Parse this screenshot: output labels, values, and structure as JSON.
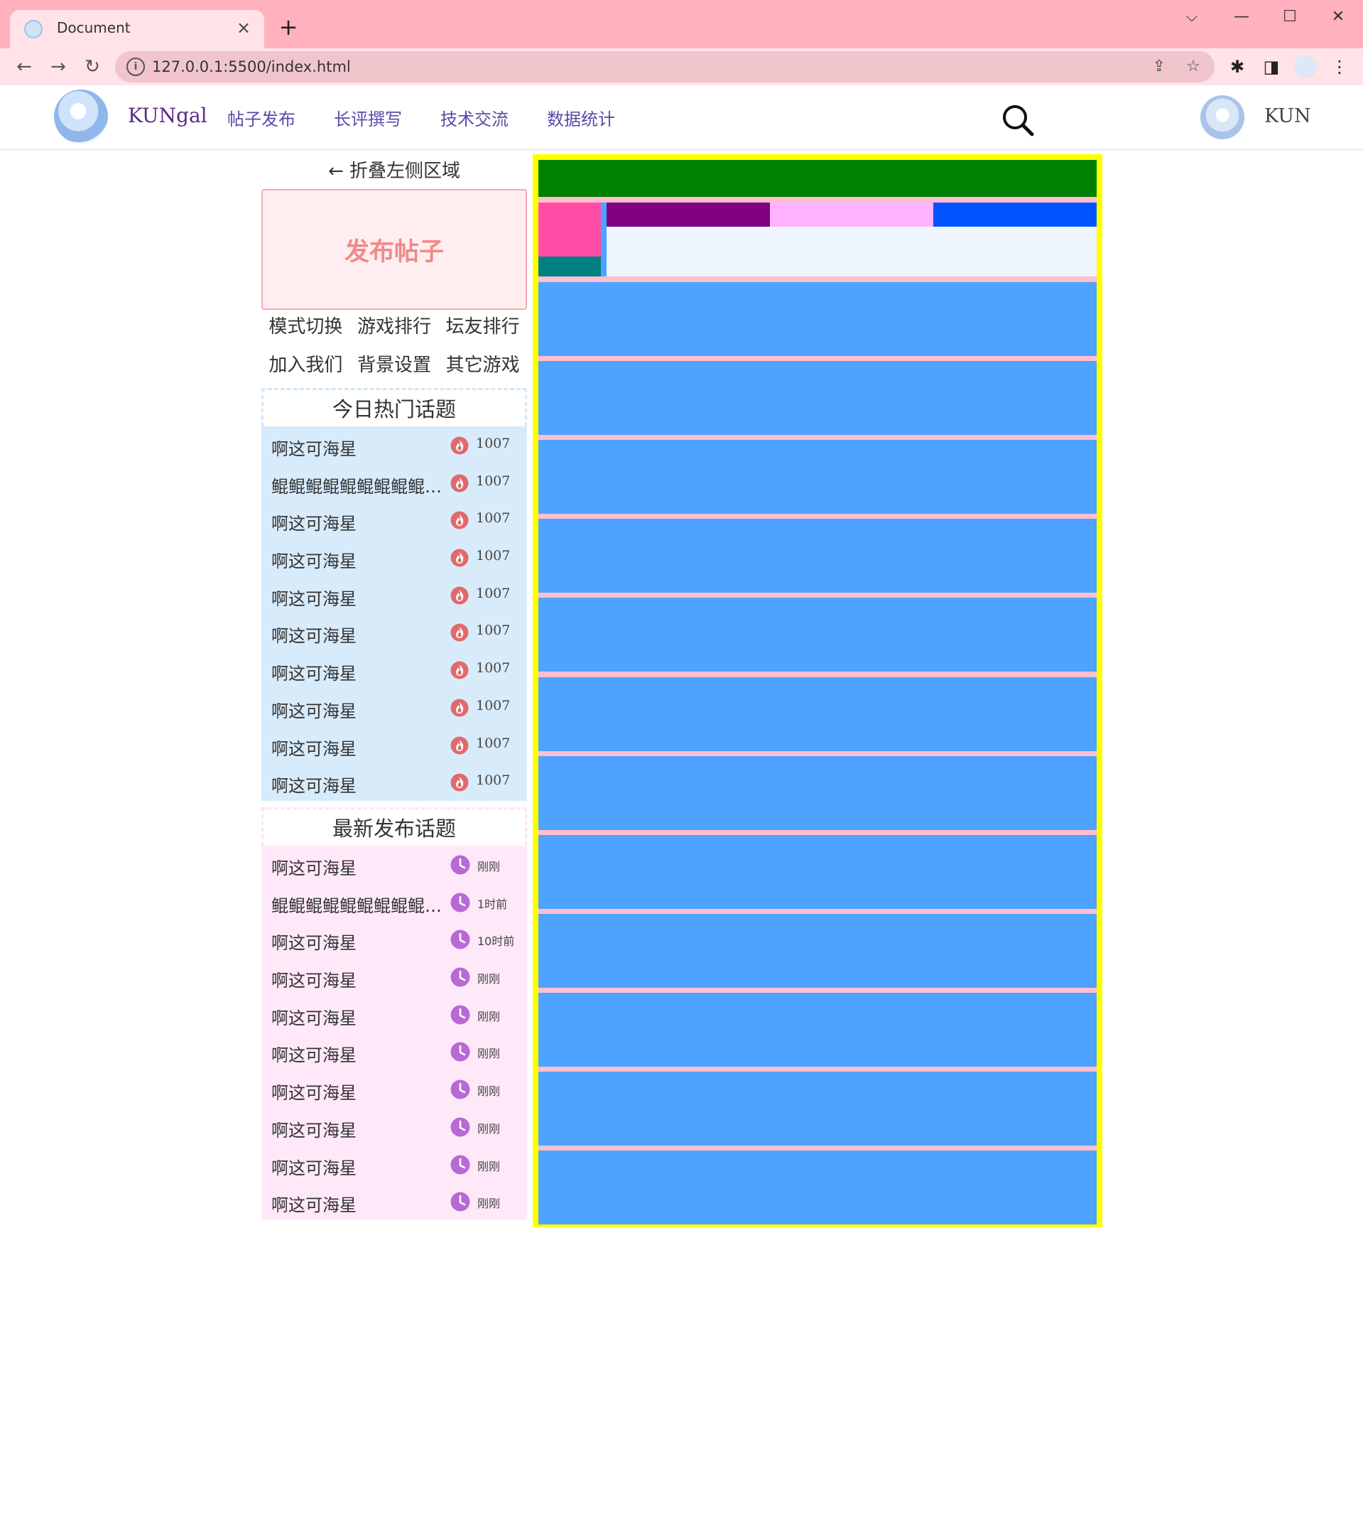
{
  "browser": {
    "tab_title": "Document",
    "tab_close": "×",
    "new_tab": "+",
    "url": "127.0.0.1:5500/index.html",
    "controls": {
      "dropdown": "⌵",
      "minimize": "—",
      "maximize": "☐",
      "close": "✕"
    }
  },
  "header": {
    "brand": "KUNgal",
    "nav": [
      "帖子发布",
      "长评撰写",
      "技术交流",
      "数据统计"
    ],
    "username": "KUN"
  },
  "sidebar": {
    "collapse_label": "折叠左侧区域",
    "publish_label": "发布帖子",
    "quick_links": [
      "模式切换",
      "游戏排行",
      "坛友排行",
      "加入我们",
      "背景设置",
      "其它游戏"
    ],
    "hot_topics": {
      "title": "今日热门话题",
      "items": [
        {
          "title": "啊这可海星",
          "count": "1007"
        },
        {
          "title": "鲲鲲鲲鲲鲲鲲鲲鲲鲲鲲鲲",
          "count": "1007"
        },
        {
          "title": "啊这可海星",
          "count": "1007"
        },
        {
          "title": "啊这可海星",
          "count": "1007"
        },
        {
          "title": "啊这可海星",
          "count": "1007"
        },
        {
          "title": "啊这可海星",
          "count": "1007"
        },
        {
          "title": "啊这可海星",
          "count": "1007"
        },
        {
          "title": "啊这可海星",
          "count": "1007"
        },
        {
          "title": "啊这可海星",
          "count": "1007"
        },
        {
          "title": "啊这可海星",
          "count": "1007"
        }
      ]
    },
    "new_topics": {
      "title": "最新发布话题",
      "items": [
        {
          "title": "啊这可海星",
          "time": "刚刚"
        },
        {
          "title": "鲲鲲鲲鲲鲲鲲鲲鲲鲲鲲鲲",
          "time": "1时前"
        },
        {
          "title": "啊这可海星",
          "time": "10时前"
        },
        {
          "title": "啊这可海星",
          "time": "刚刚"
        },
        {
          "title": "啊这可海星",
          "time": "刚刚"
        },
        {
          "title": "啊这可海星",
          "time": "刚刚"
        },
        {
          "title": "啊这可海星",
          "time": "刚刚"
        },
        {
          "title": "啊这可海星",
          "time": "刚刚"
        },
        {
          "title": "啊这可海星",
          "time": "刚刚"
        },
        {
          "title": "啊这可海星",
          "time": "刚刚"
        }
      ]
    }
  },
  "colors": {
    "main_border": "#ffff00",
    "top_bar": "#008000",
    "post_card": "#4da3ff",
    "separator": "#ffbfd0",
    "hot_panel": "#d8ebfb",
    "new_panel": "#ffe9f9",
    "fire": "#e06a6a",
    "clock": "#b76ad6"
  },
  "main": {
    "post_count": 12
  }
}
